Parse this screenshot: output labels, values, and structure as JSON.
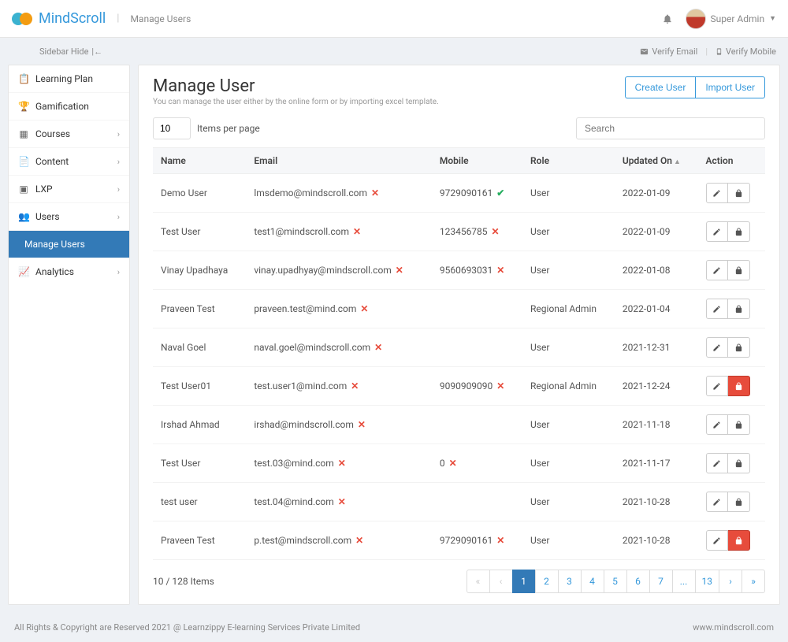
{
  "brand": "MindScroll",
  "breadcrumb": "Manage Users",
  "topbar": {
    "bell_label": "notifications",
    "user_name": "Super Admin"
  },
  "subbar": {
    "sidebar_hide": "Sidebar Hide",
    "verify_email": "Verify Email",
    "verify_mobile": "Verify Mobile"
  },
  "sidebar": {
    "items": [
      {
        "label": "Learning Plan",
        "has_children": false
      },
      {
        "label": "Gamification",
        "has_children": false
      },
      {
        "label": "Courses",
        "has_children": true
      },
      {
        "label": "Content",
        "has_children": true
      },
      {
        "label": "LXP",
        "has_children": true
      },
      {
        "label": "Users",
        "has_children": true
      },
      {
        "label": "Manage Users",
        "active": true
      },
      {
        "label": "Analytics",
        "has_children": true
      }
    ]
  },
  "page": {
    "title": "Manage User",
    "subtitle": "You can manage the user either by the online form or by importing excel template.",
    "create_btn": "Create User",
    "import_btn": "Import User",
    "items_per_page_value": "10",
    "items_per_page_label": "Items per page",
    "search_placeholder": "Search"
  },
  "columns": {
    "name": "Name",
    "email": "Email",
    "mobile": "Mobile",
    "role": "Role",
    "updated": "Updated On",
    "action": "Action"
  },
  "rows": [
    {
      "name": "Demo User",
      "email": "lmsdemo@mindscroll.com",
      "email_v": false,
      "mobile": "9729090161",
      "mobile_v": true,
      "role": "User",
      "updated": "2022-01-09",
      "locked": false
    },
    {
      "name": "Test User",
      "email": "test1@mindscroll.com",
      "email_v": false,
      "mobile": "123456785",
      "mobile_v": false,
      "role": "User",
      "updated": "2022-01-09",
      "locked": false
    },
    {
      "name": "Vinay Upadhaya",
      "email": "vinay.upadhyay@mindscroll.com",
      "email_v": false,
      "mobile": "9560693031",
      "mobile_v": false,
      "role": "User",
      "updated": "2022-01-08",
      "locked": false
    },
    {
      "name": "Praveen Test",
      "email": "praveen.test@mind.com",
      "email_v": false,
      "mobile": "",
      "mobile_v": null,
      "role": "Regional Admin",
      "updated": "2022-01-04",
      "locked": false
    },
    {
      "name": "Naval Goel",
      "email": "naval.goel@mindscroll.com",
      "email_v": false,
      "mobile": "",
      "mobile_v": null,
      "role": "User",
      "updated": "2021-12-31",
      "locked": false
    },
    {
      "name": "Test User01",
      "email": "test.user1@mind.com",
      "email_v": false,
      "mobile": "9090909090",
      "mobile_v": false,
      "role": "Regional Admin",
      "updated": "2021-12-24",
      "locked": true
    },
    {
      "name": "Irshad Ahmad",
      "email": "irshad@mindscroll.com",
      "email_v": false,
      "mobile": "",
      "mobile_v": null,
      "role": "User",
      "updated": "2021-11-18",
      "locked": false
    },
    {
      "name": "Test User",
      "email": "test.03@mind.com",
      "email_v": false,
      "mobile": "0",
      "mobile_v": false,
      "role": "User",
      "updated": "2021-11-17",
      "locked": false
    },
    {
      "name": "test user",
      "email": "test.04@mind.com",
      "email_v": false,
      "mobile": "",
      "mobile_v": null,
      "role": "User",
      "updated": "2021-10-28",
      "locked": false
    },
    {
      "name": "Praveen Test",
      "email": "p.test@mindscroll.com",
      "email_v": false,
      "mobile": "9729090161",
      "mobile_v": false,
      "role": "User",
      "updated": "2021-10-28",
      "locked": true
    }
  ],
  "pagination": {
    "count_text": "10 / 128 Items",
    "current": 1,
    "pages": [
      "1",
      "2",
      "3",
      "4",
      "5",
      "6",
      "7",
      "...",
      "13"
    ]
  },
  "footer": {
    "left": "All Rights & Copyright are Reserved 2021 @ Learnzippy E-learning Services Private Limited",
    "right": "www.mindscroll.com"
  }
}
